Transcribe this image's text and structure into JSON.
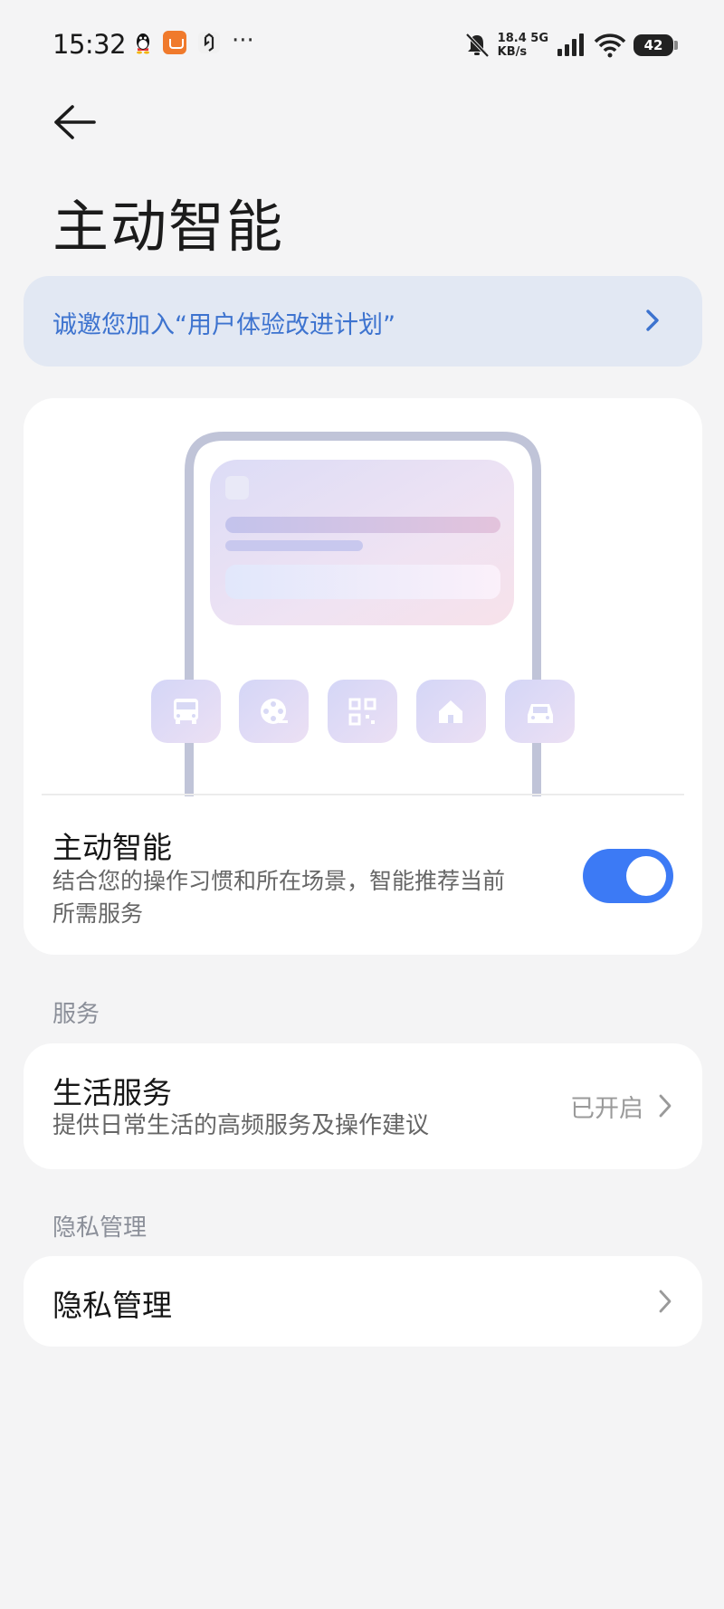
{
  "status_bar": {
    "time": "15:32",
    "more": "···",
    "net_speed_value": "18.4",
    "net_speed_unit": "KB/s",
    "network": "5G",
    "battery": "42",
    "icons": [
      "qq-icon",
      "shop-app-icon",
      "app-c-icon",
      "mute-bell-icon",
      "signal-icon",
      "wifi-icon",
      "battery-icon"
    ]
  },
  "header": {
    "title": "主动智能"
  },
  "invite_banner": {
    "text": "诚邀您加入“用户体验改进计划”"
  },
  "smart_card": {
    "title": "主动智能",
    "subtitle_line1": "结合您的操作习惯和所在场景，智能推荐当前",
    "subtitle_line2": "所需服务",
    "toggle_on": true,
    "illustration_icons": [
      "bus-icon",
      "film-reel-icon",
      "qr-code-icon",
      "home-icon",
      "car-icon"
    ]
  },
  "services_section": {
    "label": "服务",
    "item": {
      "title": "生活服务",
      "subtitle": "提供日常生活的高频服务及操作建议",
      "status": "已开启"
    }
  },
  "privacy_section": {
    "label": "隐私管理",
    "item": {
      "title": "隐私管理"
    }
  },
  "colors": {
    "accent": "#3c7af5",
    "banner_bg": "#e2e8f3",
    "banner_text": "#3d73cf",
    "page_bg": "#f4f4f5"
  }
}
